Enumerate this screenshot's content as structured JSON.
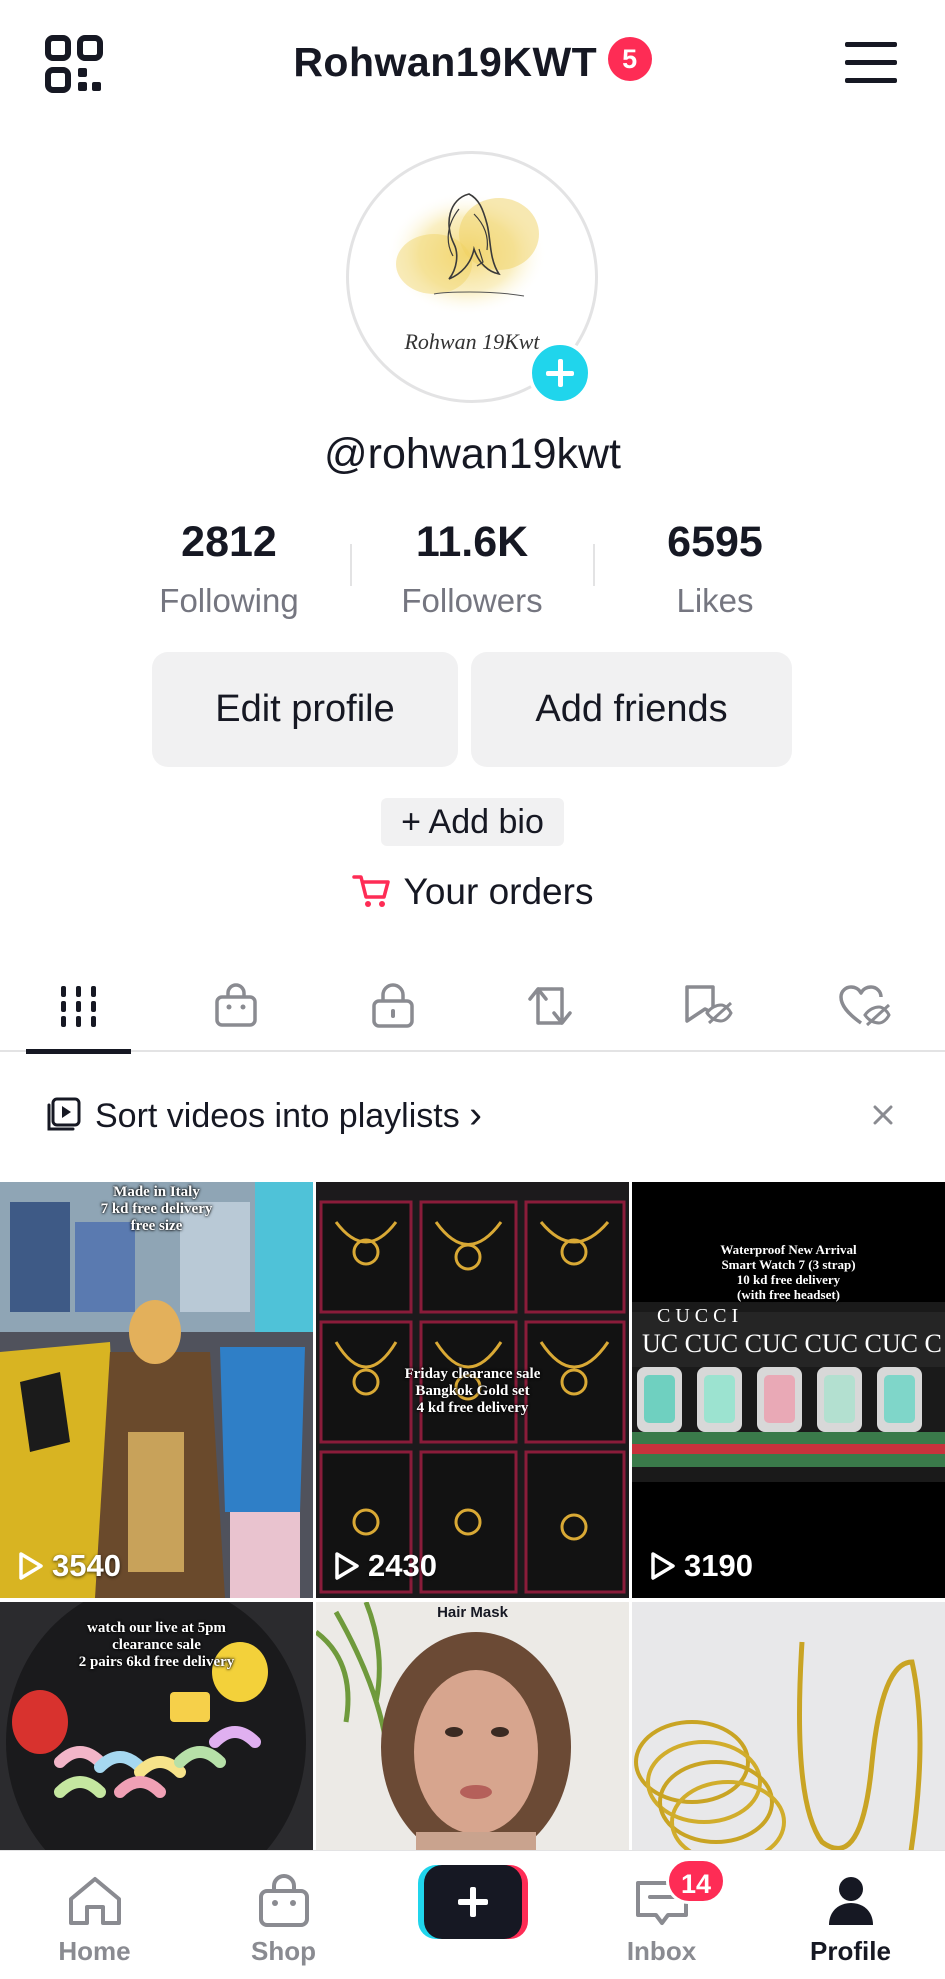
{
  "header": {
    "username": "Rohwan19KWT",
    "notification_count": "5",
    "qr_icon": "qr-code-icon",
    "menu_icon": "hamburger-menu-icon"
  },
  "profile": {
    "avatar_signature": "Rohwan 19Kwt",
    "handle": "@rohwan19kwt",
    "stats": [
      {
        "value": "2812",
        "label": "Following"
      },
      {
        "value": "11.6K",
        "label": "Followers"
      },
      {
        "value": "6595",
        "label": "Likes"
      }
    ],
    "edit_profile_label": "Edit profile",
    "add_friends_label": "Add friends",
    "add_bio_label": "+ Add bio",
    "orders_label": "Your orders"
  },
  "tabs": [
    "videos-grid-icon",
    "shop-bag-icon",
    "locked-icon",
    "repost-icon",
    "favorites-hidden-icon",
    "liked-hidden-icon"
  ],
  "playlist_prompt": {
    "text": "Sort videos into playlists",
    "chevron": "›"
  },
  "videos": [
    {
      "caption": "Made in Italy\n7 kd free delivery\nfree size",
      "views": "3540"
    },
    {
      "caption": "Friday clearance sale\nBangkok Gold set\n4 kd free delivery",
      "views": "2430"
    },
    {
      "caption": "Waterproof New Arrival\nSmart Watch 7 (3 strap)\n10 kd free delivery\n(with free headset)",
      "views": "3190"
    },
    {
      "caption": "watch our live at 5pm\nclearance sale\n2 pairs 6kd free delivery",
      "views": ""
    },
    {
      "caption": "Hair Mask",
      "views": ""
    },
    {
      "caption": "",
      "views": ""
    }
  ],
  "bottom_nav": {
    "home": "Home",
    "shop": "Shop",
    "inbox": "Inbox",
    "inbox_badge": "14",
    "profile": "Profile"
  },
  "colors": {
    "accent_red": "#fe2c55",
    "accent_cyan": "#20d5ec",
    "text_primary": "#161823",
    "text_secondary": "#757680",
    "button_bg": "#f1f1f2"
  }
}
